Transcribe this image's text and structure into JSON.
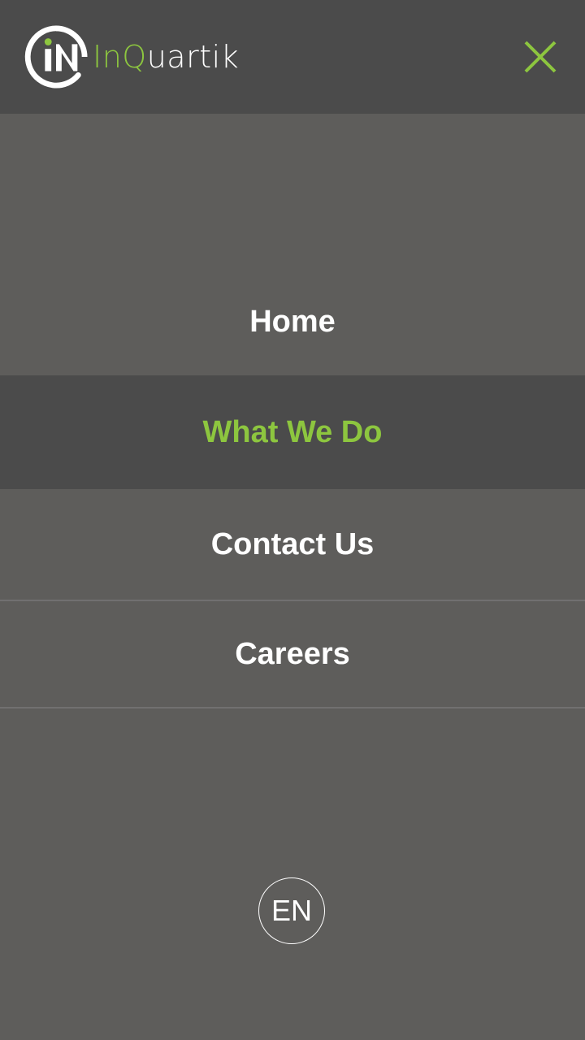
{
  "brand": {
    "name_part1": "In",
    "name_part2": "Q",
    "name_part3": "uartik",
    "mark_text": "iN",
    "accent_color": "#8dc63f"
  },
  "header": {
    "close_icon": "close-icon"
  },
  "menu": {
    "items": [
      {
        "label": "Home",
        "active": false
      },
      {
        "label": "What We Do",
        "active": true
      },
      {
        "label": "Contact Us",
        "active": false
      },
      {
        "label": "Careers",
        "active": false
      }
    ]
  },
  "language": {
    "label": "EN"
  }
}
